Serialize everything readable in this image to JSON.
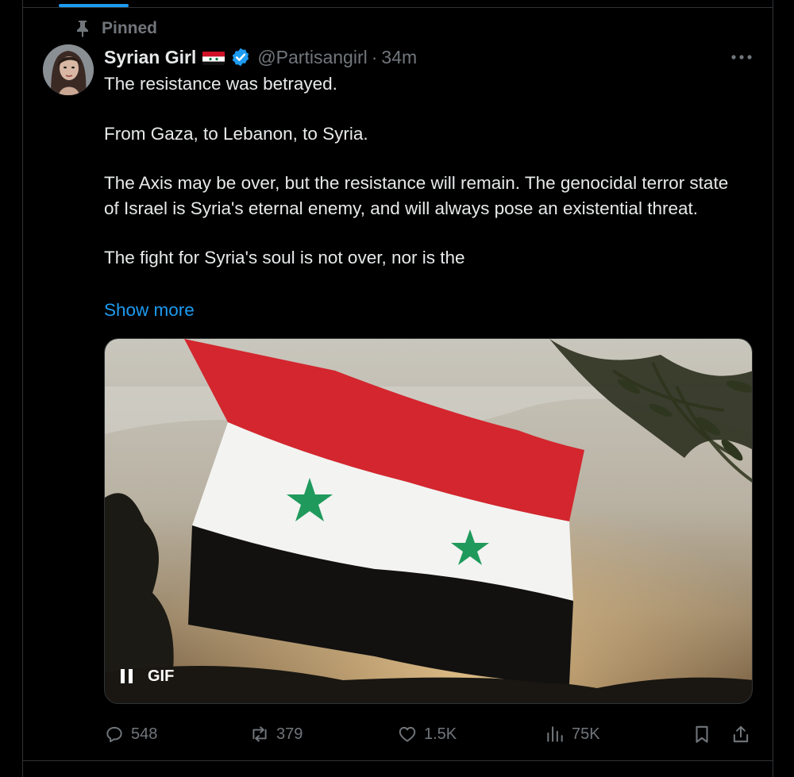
{
  "header": {
    "pinned_label": "Pinned"
  },
  "tweet": {
    "author_name": "Syrian Girl",
    "author_handle": "@Partisangirl",
    "separator": "·",
    "timestamp": "34m",
    "paragraphs": [
      "The resistance was betrayed.",
      "From Gaza, to Lebanon, to Syria.",
      "The Axis may be over, but the resistance will remain.  The genocidal terror state of Israel is Syria's eternal enemy, and will always pose an existential threat.",
      "The fight for Syria's soul is not over, nor is the"
    ],
    "show_more_label": "Show more",
    "media": {
      "type_label": "GIF",
      "icon": "pause-icon"
    }
  },
  "actions": {
    "replies": "548",
    "reposts": "379",
    "likes": "1.5K",
    "views": "75K"
  },
  "colors": {
    "background": "#000000",
    "text": "#e7e9ea",
    "secondary": "#71767b",
    "accent": "#1d9bf0",
    "border": "#2f3336"
  },
  "icons": [
    "pin-icon",
    "verified-badge-icon",
    "more-icon",
    "reply-icon",
    "repost-icon",
    "like-icon",
    "views-icon",
    "bookmark-icon",
    "share-icon",
    "syrian-flag-emoji"
  ]
}
